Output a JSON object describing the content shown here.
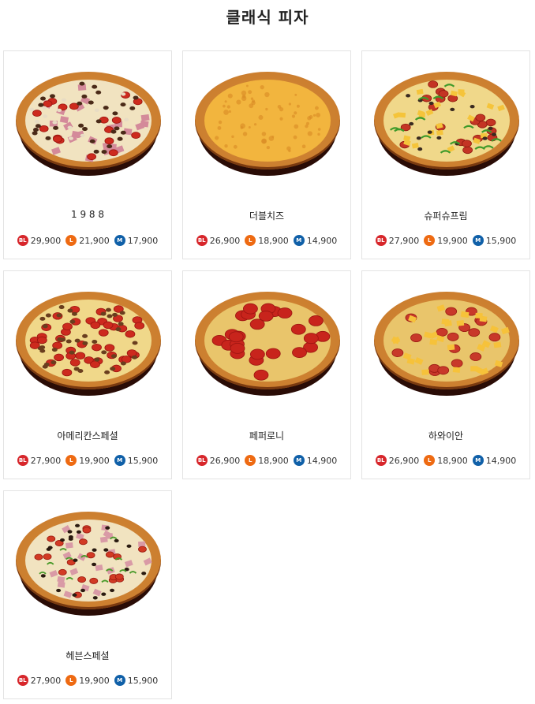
{
  "page": {
    "title": "클래식 피자"
  },
  "colors": {
    "bl_badge": "#d7262b",
    "l_badge": "#ee6a12",
    "m_badge": "#1060a8",
    "card_border": "#e3e3e3"
  },
  "badges": {
    "bl": "BL",
    "l": "L",
    "m": "M"
  },
  "pizzas": [
    {
      "name": "1 9 8 8",
      "bl": "29,900",
      "l": "21,900",
      "m": "17,900",
      "style": "combo"
    },
    {
      "name": "더블치즈",
      "bl": "26,900",
      "l": "18,900",
      "m": "14,900",
      "style": "cheese"
    },
    {
      "name": "슈퍼슈프림",
      "bl": "27,900",
      "l": "19,900",
      "m": "15,900",
      "style": "supreme"
    },
    {
      "name": "아메리칸스페셜",
      "bl": "27,900",
      "l": "19,900",
      "m": "15,900",
      "style": "american"
    },
    {
      "name": "페퍼로니",
      "bl": "26,900",
      "l": "18,900",
      "m": "14,900",
      "style": "pepperoni"
    },
    {
      "name": "하와이안",
      "bl": "26,900",
      "l": "18,900",
      "m": "14,900",
      "style": "hawaiian"
    },
    {
      "name": "헤븐스페셜",
      "bl": "27,900",
      "l": "19,900",
      "m": "15,900",
      "style": "heaven"
    }
  ]
}
